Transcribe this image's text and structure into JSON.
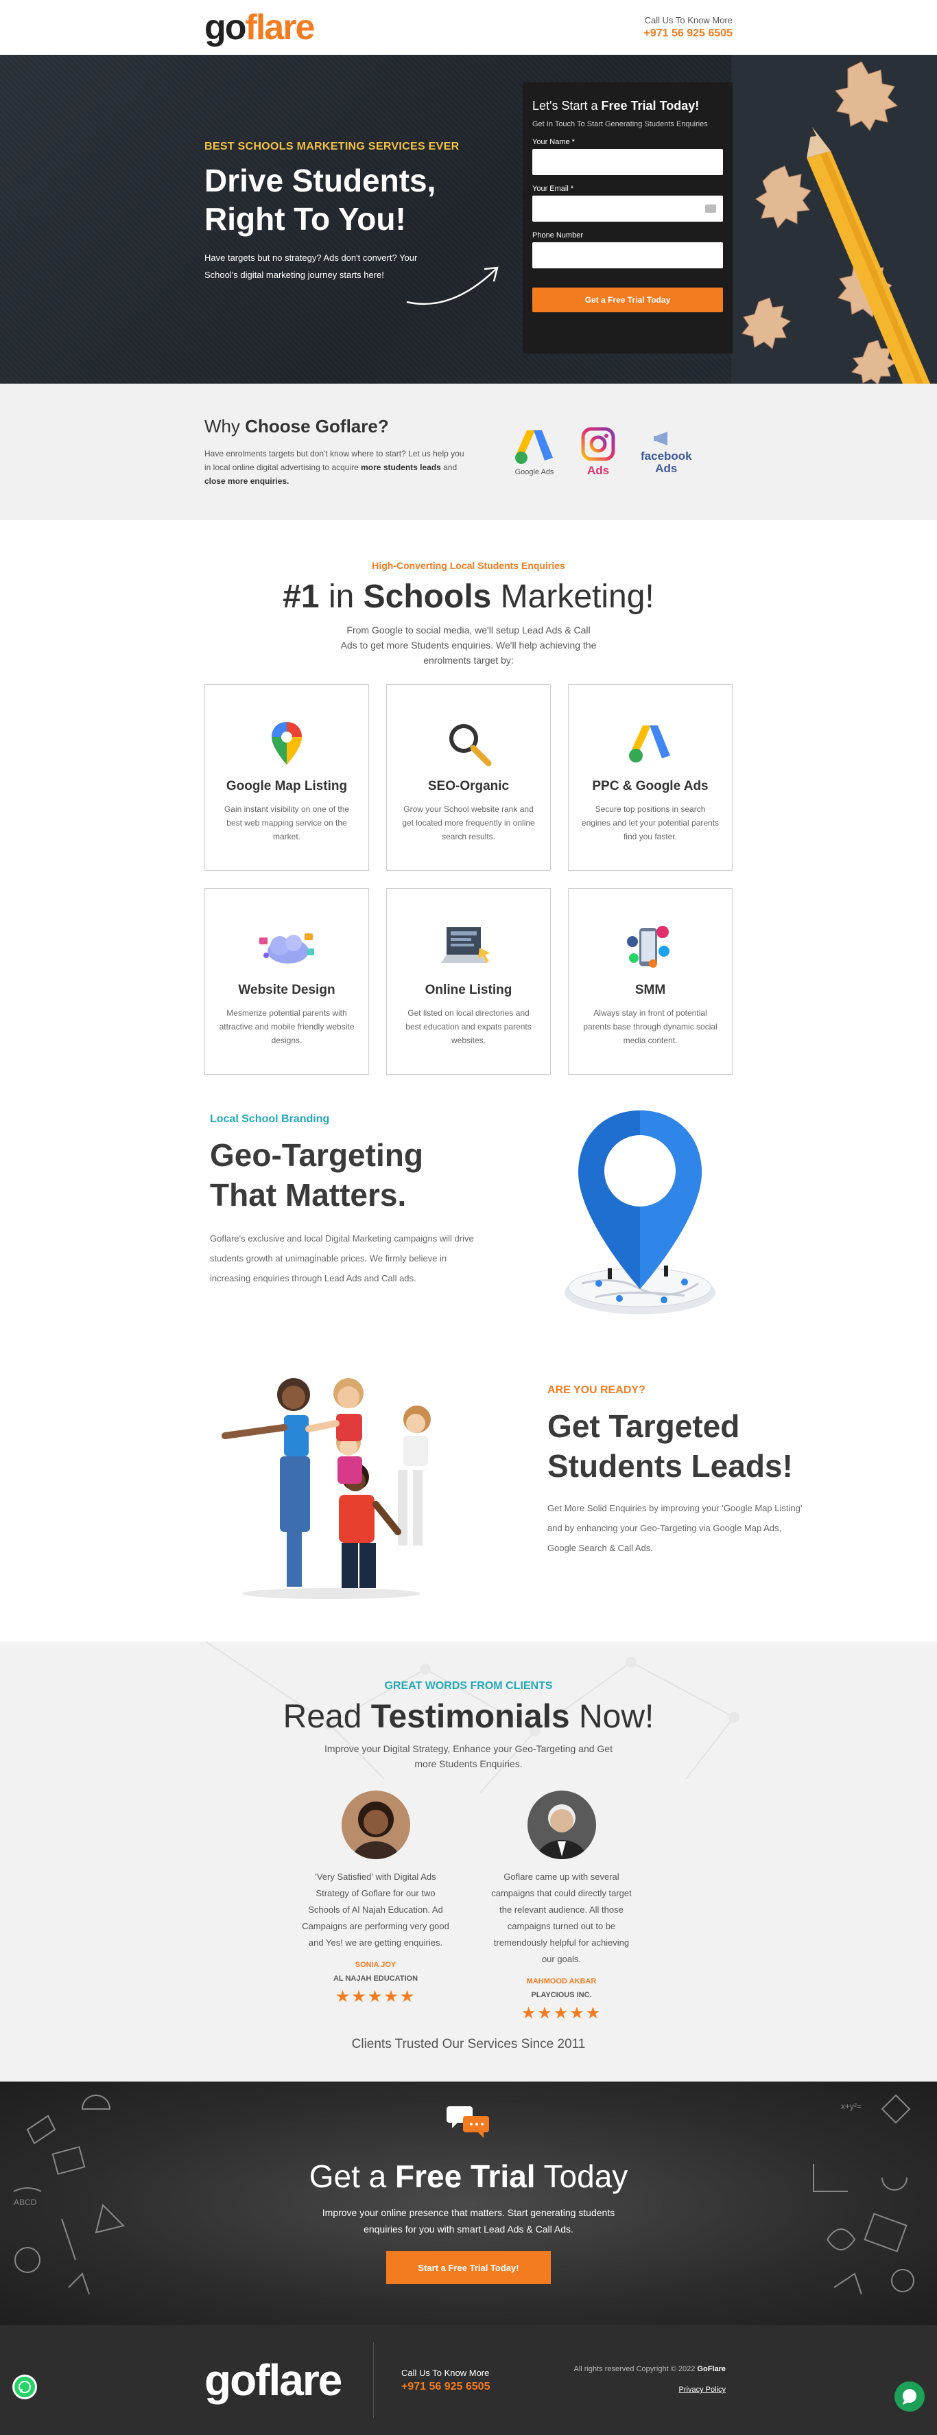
{
  "header": {
    "logo_go": "go",
    "logo_flare": "flare",
    "call_label": "Call Us To Know More",
    "phone": "+971 56 925 6505"
  },
  "hero": {
    "kicker": "BEST SCHOOLS MARKETING SERVICES EVER",
    "title_line1": "Drive Students,",
    "title_line2": "Right To You!",
    "text": "Have targets but no strategy? Ads don't convert? Your School's digital marketing journey starts here!",
    "form": {
      "title_pre": "Let's Start a ",
      "title_bold": "Free Trial Today!",
      "subtitle": "Get In Touch To Start Generating Students Enquiries",
      "name_label": "Your Name *",
      "email_label": "Your Email *",
      "phone_label": "Phone Number",
      "submit": "Get a Free Trial Today"
    }
  },
  "why": {
    "title_pre": "Why ",
    "title_bold": "Choose Goflare?",
    "text_pre": "Have enrolments targets but don't know where to start? Let us help you in local online digital advertising to acquire ",
    "text_b1": "more students leads",
    "text_mid": " and ",
    "text_b2": "close more enquiries.",
    "logos": {
      "google_ads": "Google Ads",
      "insta_ads": "Ads",
      "fb_line1": "facebook",
      "fb_line2": "Ads"
    }
  },
  "services": {
    "kicker": "High-Converting Local Students Enquiries",
    "title_b1": "#1",
    "title_mid": " in ",
    "title_b2": "Schools",
    "title_end": " Marketing!",
    "subtitle": "From Google to social media, we'll setup Lead Ads & Call Ads to get more Students enquiries. We'll help achieving the enrolments target by:",
    "cards": [
      {
        "title": "Google Map Listing",
        "text": "Gain instant visibility on one of the best web mapping service on the market.",
        "icon": "map-pin-icon"
      },
      {
        "title": "SEO-Organic",
        "text": "Grow your School website rank and get located more frequently in online search results.",
        "icon": "magnifier-icon"
      },
      {
        "title": "PPC & Google Ads",
        "text": "Secure top positions in search engines and let your potential parents find you faster.",
        "icon": "google-ads-icon"
      },
      {
        "title": "Website Design",
        "text": "Mesmerize potential parents with attractive and mobile friendly website designs.",
        "icon": "cloud-web-icon"
      },
      {
        "title": "Online Listing",
        "text": "Get listed on local directories and best education and expats parents websites.",
        "icon": "listing-board-icon"
      },
      {
        "title": "SMM",
        "text": "Always stay in front of potential parents base through dynamic social media content.",
        "icon": "social-phone-icon"
      }
    ]
  },
  "geo": {
    "kicker": "Local School Branding",
    "title_line1": "Geo-Targeting",
    "title_line2": "That Matters.",
    "text": "Goflare's exclusive and local Digital Marketing campaigns will drive students growth at unimaginable prices. We firmly believe in increasing enquiries through Lead Ads and Call ads."
  },
  "leads": {
    "kicker": "ARE YOU READY?",
    "title_line1": "Get Targeted",
    "title_line2": "Students Leads!",
    "text": "Get More Solid Enquiries by improving your 'Google Map Listing' and by enhancing your Geo-Targeting via Google Map Ads, Google Search & Call Ads."
  },
  "testimonials": {
    "kicker": "GREAT WORDS FROM CLIENTS",
    "title_pre": "Read ",
    "title_bold": "Testimonials",
    "title_end": " Now!",
    "subtitle": "Improve your Digital Strategy, Enhance your Geo-Targeting and Get more Students Enquiries.",
    "items": [
      {
        "quote": "'Very Satisfied' with Digital Ads Strategy of Goflare for our two Schools of Al Najah Education. Ad Campaigns are performing very good and Yes! we are getting enquiries.",
        "name": "SONIA JOY",
        "company": "AL NAJAH EDUCATION",
        "stars": "★★★★★"
      },
      {
        "quote": "Goflare came up with several campaigns that could directly target the relevant audience. All those campaigns turned out to be tremendously helpful for achieving our goals.",
        "name": "MAHMOOD AKBAR",
        "company": "PLAYCIOUS INC.",
        "stars": "★★★★★"
      }
    ],
    "trusted": "Clients Trusted Our Services Since 2011"
  },
  "trial": {
    "title_pre": "Get a ",
    "title_bold": "Free Trial",
    "title_end": " Today",
    "text": "Improve your online presence that matters. Start generating students enquiries for you with smart Lead Ads & Call Ads.",
    "button": "Start a Free Trial Today!"
  },
  "footer": {
    "logo": "goflare",
    "call_label": "Call Us To Know More",
    "phone": "+971 56 925 6505",
    "copyright_pre": "All rights reserved Copyright © 2022 ",
    "copyright_bold": "GoFlare",
    "privacy": "Privacy Policy"
  },
  "colors": {
    "accent": "#f47c20",
    "teal": "#23a8b7",
    "hero_kicker": "#f5c242"
  }
}
